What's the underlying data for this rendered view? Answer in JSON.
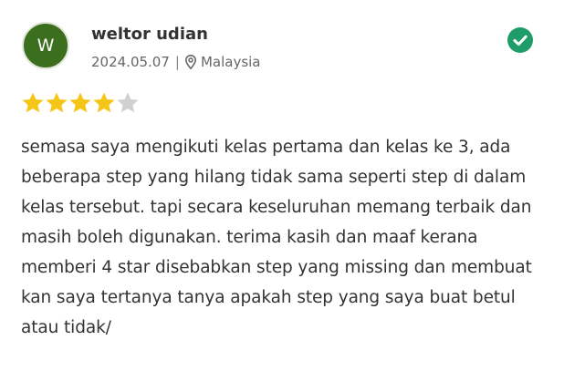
{
  "reviewer": {
    "avatar_initial": "W",
    "avatar_color": "#3b6e1d",
    "name": "weltor udian",
    "date": "2024.05.07",
    "separator": "|",
    "location_icon": "map-pin-icon",
    "location": "Malaysia",
    "verified_icon": "check-circle-icon",
    "verified_color": "#1f9d68"
  },
  "rating": {
    "value": 4,
    "max": 5,
    "filled_color": "#f5c518",
    "empty_color": "#d0d0d0"
  },
  "review": {
    "text": "semasa saya mengikuti kelas pertama dan kelas ke 3, ada beberapa step yang hilang tidak sama seperti step di dalam kelas tersebut. tapi secara keseluruhan memang terbaik dan masih boleh digunakan. terima kasih dan maaf kerana memberi 4 star disebabkan step yang missing dan membuat kan saya tertanya tanya apakah step yang saya buat betul atau tidak/"
  }
}
